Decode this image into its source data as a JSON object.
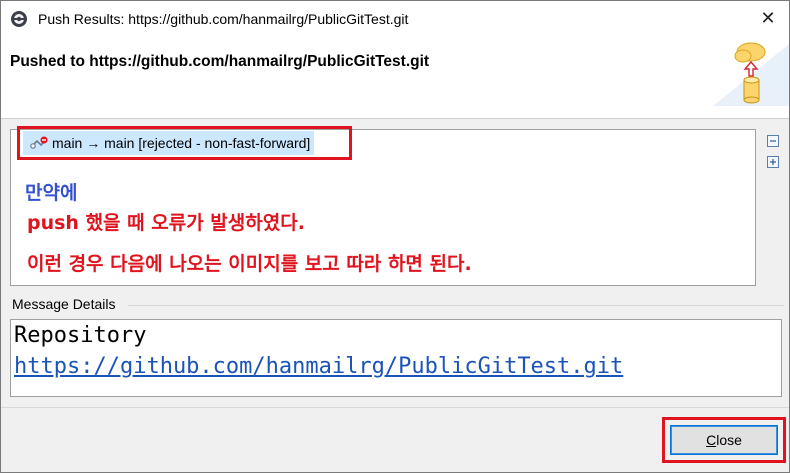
{
  "window": {
    "title": "Push Results: https://github.com/hanmailrg/PublicGitTest.git",
    "app_icon": "eclipse-gear-icon",
    "close_glyph": "✕"
  },
  "header": {
    "message": "Pushed to https://github.com/hanmailrg/PublicGitTest.git",
    "art_icon": "push-to-cloud-icon"
  },
  "results": {
    "ref_update": "main → main [rejected - non-fast-forward]",
    "ref_icon": "rejected-ref-icon",
    "annotation_line1": "만약에",
    "annotation_line2": "push 했을 때 오류가 발생하였다.",
    "annotation_line3": "이런 경우 다음에 나오는 이미지를 보고 따라 하면 된다.",
    "highlight_color": "#e0141e"
  },
  "details": {
    "label": "Message Details",
    "repo_label": "Repository",
    "repo_url": "https://github.com/hanmailrg/PublicGitTest.git"
  },
  "footer": {
    "close_mnemonic": "C",
    "close_rest": "lose"
  }
}
